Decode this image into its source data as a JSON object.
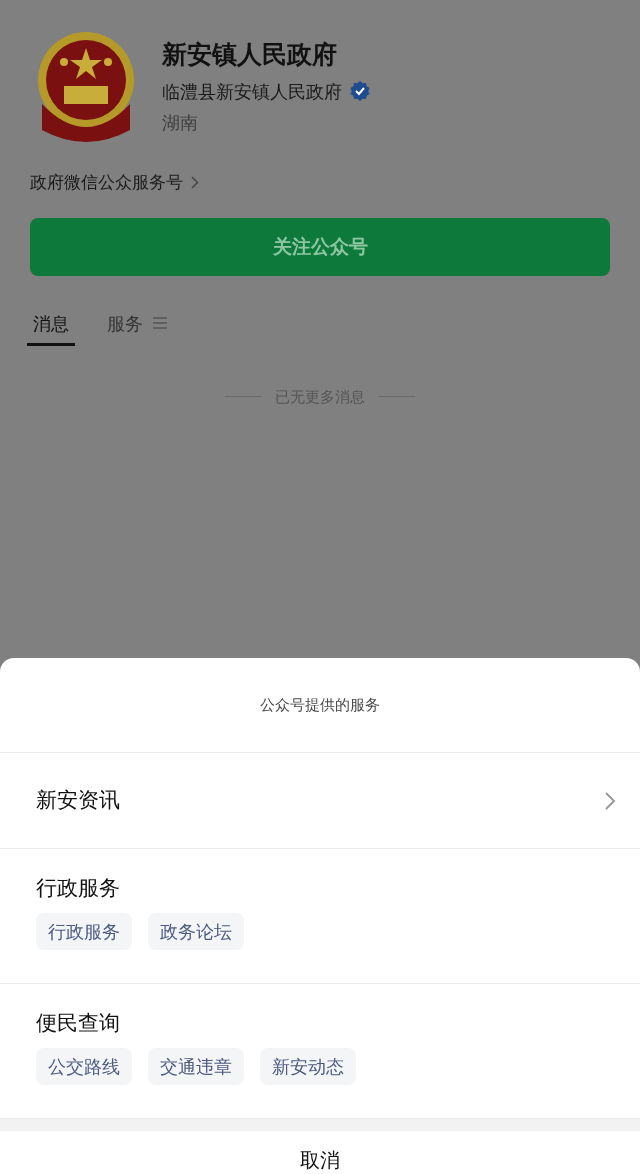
{
  "profile": {
    "name": "新安镇人民政府",
    "entity": "临澧县新安镇人民政府",
    "verified": true,
    "region": "湖南"
  },
  "account_type": "政府微信公众服务号",
  "follow_button": "关注公众号",
  "tabs": [
    {
      "label": "消息",
      "selected": true,
      "has_menu": false
    },
    {
      "label": "服务",
      "selected": false,
      "has_menu": true
    }
  ],
  "end_note": "已无更多消息",
  "sheet": {
    "title": "公众号提供的服务",
    "sections": [
      {
        "kind": "link",
        "title": "新安资讯"
      },
      {
        "kind": "group",
        "title": "行政服务",
        "items": [
          "行政服务",
          "政务论坛"
        ]
      },
      {
        "kind": "group",
        "title": "便民查询",
        "items": [
          "公交路线",
          "交通违章",
          "新安动态"
        ]
      }
    ],
    "cancel": "取消"
  }
}
